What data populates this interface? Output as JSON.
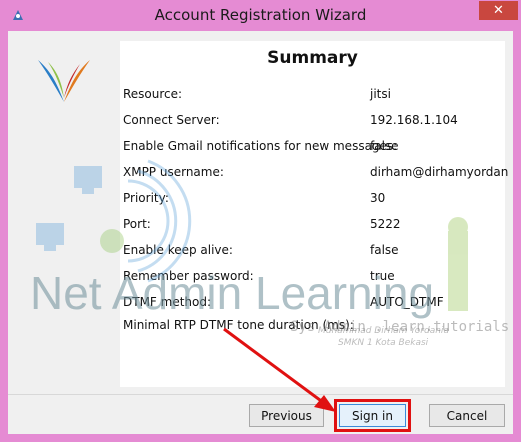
{
  "window": {
    "title": "Account Registration Wizard",
    "close_label": "✕"
  },
  "summary": {
    "title": "Summary",
    "rows": [
      {
        "label": "Resource:",
        "value": "jitsi"
      },
      {
        "label": "Connect Server:",
        "value": "192.168.1.104"
      },
      {
        "label": "Enable Gmail notifications for new messages:",
        "value": "false"
      },
      {
        "label": "XMPP username:",
        "value": "dirham@dirhamyordan"
      },
      {
        "label": "Priority:",
        "value": "30"
      },
      {
        "label": "Port:",
        "value": "5222"
      },
      {
        "label": "Enable keep alive:",
        "value": "false"
      },
      {
        "label": "Remember password:",
        "value": "true"
      },
      {
        "label": "DTMF method:",
        "value": "AUTO_DTMF"
      },
      {
        "label": "Minimal RTP DTMF tone duration (ms):",
        "value": ""
      }
    ]
  },
  "watermark": {
    "main": "Net Admin Learning",
    "line1": "Sys Admin .learn.tutorials",
    "line2": "Muhammad Dirham Yordania",
    "line3": "SMKN 1 Kota Bekasi"
  },
  "buttons": {
    "previous": "Previous",
    "sign_in": "Sign in",
    "cancel": "Cancel"
  },
  "colors": {
    "window_frame": "#e58bd3",
    "highlight": "#e01111",
    "close": "#c9473f"
  },
  "icons": {
    "app": "jitsi-app-icon",
    "logo": "xmpp-logo-icon",
    "arrow": "red-arrow-annotation"
  }
}
